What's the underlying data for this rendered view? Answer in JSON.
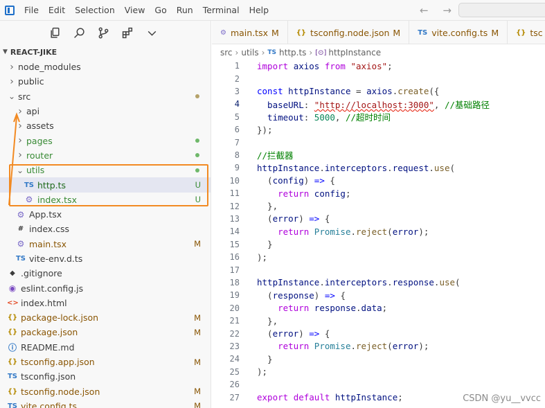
{
  "menu": [
    "File",
    "Edit",
    "Selection",
    "View",
    "Go",
    "Run",
    "Terminal",
    "Help"
  ],
  "nav_arrows": "← →",
  "explorer": {
    "root": "REACT-JIKE",
    "rows": [
      {
        "twist": "›",
        "icon": "",
        "label": "node_modules",
        "badge": "",
        "indent": 0,
        "cls": ""
      },
      {
        "twist": "›",
        "icon": "",
        "label": "public",
        "badge": "",
        "indent": 0,
        "cls": ""
      },
      {
        "twist": "⌄",
        "icon": "",
        "label": "src",
        "badge": "",
        "indent": 0,
        "cls": "",
        "dot": "#b5a26a"
      },
      {
        "twist": "›",
        "icon": "",
        "label": "api",
        "badge": "",
        "indent": 1,
        "cls": ""
      },
      {
        "twist": "›",
        "icon": "",
        "label": "assets",
        "badge": "",
        "indent": 1,
        "cls": ""
      },
      {
        "twist": "›",
        "icon": "",
        "label": "pages",
        "badge": "",
        "indent": 1,
        "cls": "green",
        "dot": "#6fb86a"
      },
      {
        "twist": "›",
        "icon": "",
        "label": "router",
        "badge": "",
        "indent": 1,
        "cls": "green",
        "dot": "#6fb86a"
      },
      {
        "twist": "⌄",
        "icon": "",
        "label": "utils",
        "badge": "",
        "indent": 1,
        "cls": "green",
        "dot": "#6fb86a"
      },
      {
        "twist": "",
        "icon": "TS",
        "label": "http.ts",
        "badge": "U",
        "indent": 2,
        "cls": "green",
        "sel": true
      },
      {
        "twist": "",
        "icon": "⚙",
        "label": "index.tsx",
        "badge": "U",
        "indent": 2,
        "cls": "green"
      },
      {
        "twist": "",
        "icon": "⚙",
        "label": "App.tsx",
        "badge": "",
        "indent": 1,
        "cls": ""
      },
      {
        "twist": "",
        "icon": "#",
        "label": "index.css",
        "badge": "",
        "indent": 1,
        "cls": ""
      },
      {
        "twist": "",
        "icon": "⚙",
        "label": "main.tsx",
        "badge": "M",
        "indent": 1,
        "cls": "olive"
      },
      {
        "twist": "",
        "icon": "TS",
        "label": "vite-env.d.ts",
        "badge": "",
        "indent": 1,
        "cls": ""
      },
      {
        "twist": "",
        "icon": "◆",
        "label": ".gitignore",
        "badge": "",
        "indent": 0,
        "cls": ""
      },
      {
        "twist": "",
        "icon": "◉",
        "label": "eslint.config.js",
        "badge": "",
        "indent": 0,
        "cls": ""
      },
      {
        "twist": "",
        "icon": "<>",
        "label": "index.html",
        "badge": "",
        "indent": 0,
        "cls": ""
      },
      {
        "twist": "",
        "icon": "{}",
        "label": "package-lock.json",
        "badge": "M",
        "indent": 0,
        "cls": "olive"
      },
      {
        "twist": "",
        "icon": "{}",
        "label": "package.json",
        "badge": "M",
        "indent": 0,
        "cls": "olive"
      },
      {
        "twist": "",
        "icon": "ⓘ",
        "label": "README.md",
        "badge": "",
        "indent": 0,
        "cls": ""
      },
      {
        "twist": "",
        "icon": "{}",
        "label": "tsconfig.app.json",
        "badge": "M",
        "indent": 0,
        "cls": "olive"
      },
      {
        "twist": "",
        "icon": "TS",
        "label": "tsconfig.json",
        "badge": "",
        "indent": 0,
        "cls": ""
      },
      {
        "twist": "",
        "icon": "{}",
        "label": "tsconfig.node.json",
        "badge": "M",
        "indent": 0,
        "cls": "olive"
      },
      {
        "twist": "",
        "icon": "TS",
        "label": "vite.config.ts",
        "badge": "M",
        "indent": 0,
        "cls": "olive"
      }
    ]
  },
  "tabs": [
    {
      "icon": "⚙",
      "label": "main.tsx",
      "badge": "M"
    },
    {
      "icon": "{}",
      "label": "tsconfig.node.json",
      "badge": "M"
    },
    {
      "icon": "TS",
      "label": "vite.config.ts",
      "badge": "M"
    },
    {
      "icon": "{}",
      "label": "tsc",
      "badge": ""
    }
  ],
  "breadcrumb": {
    "p1": "src",
    "p2": "utils",
    "file_icon": "TS",
    "file": "http.ts",
    "symbol_icon": "[⊙]",
    "symbol": "httpInstance"
  },
  "code": [
    {
      "n": "1",
      "parts": [
        [
          "kw2",
          "import "
        ],
        [
          "var",
          "axios "
        ],
        [
          "kw2",
          "from "
        ],
        [
          "str",
          "\"axios\""
        ],
        [
          "punc",
          ";"
        ]
      ]
    },
    {
      "n": "2",
      "parts": []
    },
    {
      "n": "3",
      "parts": [
        [
          "kw",
          "const "
        ],
        [
          "var",
          "httpInstance "
        ],
        [
          "punc",
          "= "
        ],
        [
          "var",
          "axios"
        ],
        [
          "punc",
          "."
        ],
        [
          "fn",
          "create"
        ],
        [
          "punc",
          "({"
        ]
      ]
    },
    {
      "n": "4",
      "parts": [
        [
          "var",
          "  baseURL"
        ],
        [
          "punc",
          ": "
        ],
        [
          "str squig",
          "\"http://localhost:3000\""
        ],
        [
          "punc",
          ", "
        ],
        [
          "cm",
          "//基础路径"
        ]
      ],
      "active": true
    },
    {
      "n": "5",
      "parts": [
        [
          "var",
          "  timeout"
        ],
        [
          "punc",
          ": "
        ],
        [
          "num",
          "5000"
        ],
        [
          "punc",
          ", "
        ],
        [
          "cm",
          "//超时时间"
        ]
      ]
    },
    {
      "n": "6",
      "parts": [
        [
          "punc",
          "});"
        ]
      ]
    },
    {
      "n": "7",
      "parts": []
    },
    {
      "n": "8",
      "parts": [
        [
          "cm",
          "//拦截器"
        ]
      ]
    },
    {
      "n": "9",
      "parts": [
        [
          "var",
          "httpInstance"
        ],
        [
          "punc",
          "."
        ],
        [
          "var",
          "interceptors"
        ],
        [
          "punc",
          "."
        ],
        [
          "var",
          "request"
        ],
        [
          "punc",
          "."
        ],
        [
          "fn",
          "use"
        ],
        [
          "punc",
          "("
        ]
      ]
    },
    {
      "n": "10",
      "parts": [
        [
          "punc",
          "  ("
        ],
        [
          "var",
          "config"
        ],
        [
          "punc",
          ") "
        ],
        [
          "kw",
          "=>"
        ],
        [
          "punc",
          " {"
        ]
      ]
    },
    {
      "n": "11",
      "parts": [
        [
          "kw2",
          "    return "
        ],
        [
          "var",
          "config"
        ],
        [
          "punc",
          ";"
        ]
      ]
    },
    {
      "n": "12",
      "parts": [
        [
          "punc",
          "  },"
        ]
      ]
    },
    {
      "n": "13",
      "parts": [
        [
          "punc",
          "  ("
        ],
        [
          "var",
          "error"
        ],
        [
          "punc",
          ") "
        ],
        [
          "kw",
          "=>"
        ],
        [
          "punc",
          " {"
        ]
      ]
    },
    {
      "n": "14",
      "parts": [
        [
          "kw2",
          "    return "
        ],
        [
          "cls",
          "Promise"
        ],
        [
          "punc",
          "."
        ],
        [
          "fn",
          "reject"
        ],
        [
          "punc",
          "("
        ],
        [
          "var",
          "error"
        ],
        [
          "punc",
          ");"
        ]
      ]
    },
    {
      "n": "15",
      "parts": [
        [
          "punc",
          "  }"
        ]
      ]
    },
    {
      "n": "16",
      "parts": [
        [
          "punc",
          ");"
        ]
      ]
    },
    {
      "n": "17",
      "parts": []
    },
    {
      "n": "18",
      "parts": [
        [
          "var",
          "httpInstance"
        ],
        [
          "punc",
          "."
        ],
        [
          "var",
          "interceptors"
        ],
        [
          "punc",
          "."
        ],
        [
          "var",
          "response"
        ],
        [
          "punc",
          "."
        ],
        [
          "fn",
          "use"
        ],
        [
          "punc",
          "("
        ]
      ]
    },
    {
      "n": "19",
      "parts": [
        [
          "punc",
          "  ("
        ],
        [
          "var",
          "response"
        ],
        [
          "punc",
          ") "
        ],
        [
          "kw",
          "=>"
        ],
        [
          "punc",
          " {"
        ]
      ]
    },
    {
      "n": "20",
      "parts": [
        [
          "kw2",
          "    return "
        ],
        [
          "var",
          "response"
        ],
        [
          "punc",
          "."
        ],
        [
          "var",
          "data"
        ],
        [
          "punc",
          ";"
        ]
      ]
    },
    {
      "n": "21",
      "parts": [
        [
          "punc",
          "  },"
        ]
      ]
    },
    {
      "n": "22",
      "parts": [
        [
          "punc",
          "  ("
        ],
        [
          "var",
          "error"
        ],
        [
          "punc",
          ") "
        ],
        [
          "kw",
          "=>"
        ],
        [
          "punc",
          " {"
        ]
      ]
    },
    {
      "n": "23",
      "parts": [
        [
          "kw2",
          "    return "
        ],
        [
          "cls",
          "Promise"
        ],
        [
          "punc",
          "."
        ],
        [
          "fn",
          "reject"
        ],
        [
          "punc",
          "("
        ],
        [
          "var",
          "error"
        ],
        [
          "punc",
          ");"
        ]
      ]
    },
    {
      "n": "24",
      "parts": [
        [
          "punc",
          "  }"
        ]
      ]
    },
    {
      "n": "25",
      "parts": [
        [
          "punc",
          ");"
        ]
      ]
    },
    {
      "n": "26",
      "parts": []
    },
    {
      "n": "27",
      "parts": [
        [
          "kw2",
          "export "
        ],
        [
          "kw2",
          "default "
        ],
        [
          "var",
          "httpInstance"
        ],
        [
          "punc",
          ";"
        ]
      ]
    }
  ],
  "watermark": "CSDN @yu__vvcc",
  "colors": {
    "highlight": "#f28a22",
    "accent": "#1e6fc9"
  }
}
